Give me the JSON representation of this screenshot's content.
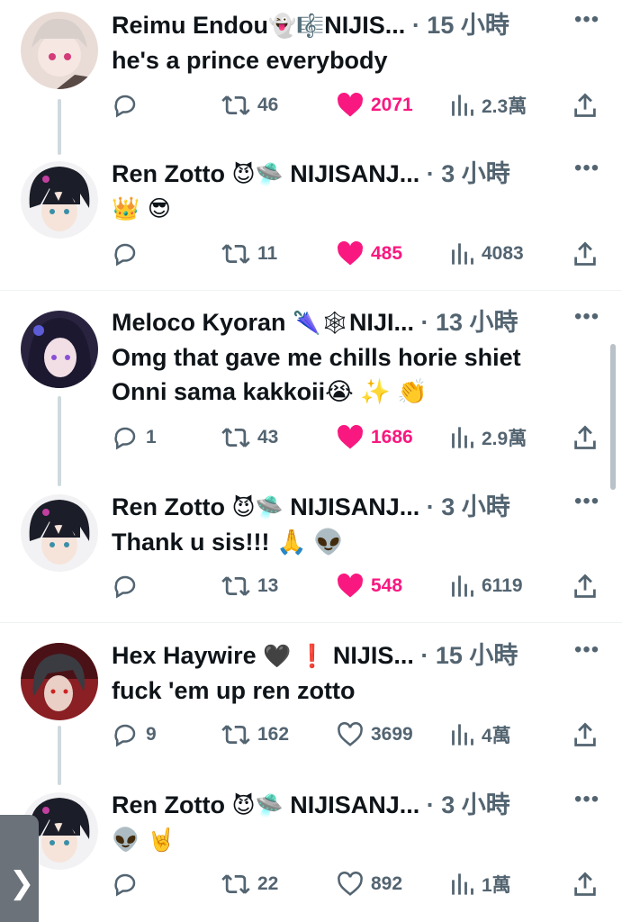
{
  "tweets": [
    {
      "name": "Reimu Endou",
      "badges": "👻🎼",
      "affiliation": "NIJIS...",
      "time": "· 15 小時",
      "more": "•••",
      "lines": [
        "he's a prince everybody"
      ],
      "avatar": "avatar-reimu",
      "replies": "",
      "retweets": "46",
      "likes": "2071",
      "liked": true,
      "views": "2.3萬"
    },
    {
      "name": "Ren Zotto",
      "badges": "😈🛸",
      "affiliation": "NIJISANJ...",
      "time": "· 3 小時",
      "more": "•••",
      "lines": [
        "👑 😎"
      ],
      "avatar": "avatar-ren",
      "replies": "",
      "retweets": "11",
      "likes": "485",
      "liked": true,
      "views": "4083"
    },
    {
      "name": "Meloco Kyoran",
      "badges": "🌂🕸",
      "affiliation": "NIJI...",
      "time": "· 13 小時",
      "more": "•••",
      "lines": [
        "Omg that gave me chills horie shiet",
        "Onni sama kakkoii😭 ✨ 👏"
      ],
      "avatar": "avatar-meloco",
      "replies": "1",
      "retweets": "43",
      "likes": "1686",
      "liked": true,
      "views": "2.9萬"
    },
    {
      "name": "Ren Zotto",
      "badges": "😈🛸",
      "affiliation": "NIJISANJ...",
      "time": "· 3 小時",
      "more": "•••",
      "lines": [
        "Thank u sis!!! 🙏 👽"
      ],
      "avatar": "avatar-ren",
      "replies": "",
      "retweets": "13",
      "likes": "548",
      "liked": true,
      "views": "6119"
    },
    {
      "name": "Hex Haywire",
      "badges": "🖤 ❗",
      "affiliation": "NIJIS...",
      "time": "· 15 小時",
      "more": "•••",
      "lines": [
        "fuck 'em up ren zotto"
      ],
      "avatar": "avatar-hex",
      "replies": "9",
      "retweets": "162",
      "likes": "3699",
      "liked": false,
      "views": "4萬"
    },
    {
      "name": "Ren Zotto",
      "badges": "😈🛸",
      "affiliation": "NIJISANJ...",
      "time": "· 3 小時",
      "more": "•••",
      "lines": [
        "👽 🤘"
      ],
      "avatar": "avatar-ren",
      "replies": "",
      "retweets": "22",
      "likes": "892",
      "liked": false,
      "views": "1萬"
    }
  ],
  "side_tab": {
    "glyph": "❯",
    "icon": "chevron-right-icon"
  },
  "colors": {
    "like": "#f91880",
    "muted": "#536471",
    "text": "#0f1419",
    "thread": "#cfd9de"
  }
}
